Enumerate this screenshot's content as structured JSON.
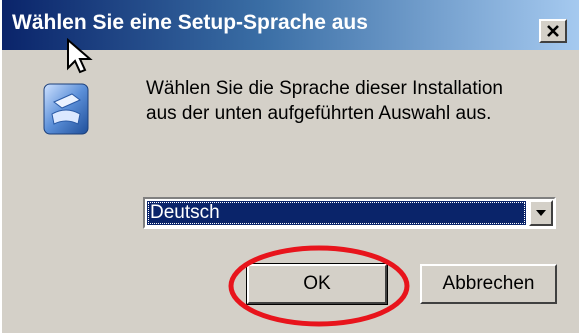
{
  "dialog": {
    "title": "Wählen Sie eine Setup-Sprache aus",
    "close_label": "✕",
    "message_lines": [
      "Wählen Sie die Sprache dieser Installation",
      "aus der unten aufgeführten Auswahl aus."
    ],
    "language_select": {
      "selected": "Deutsch"
    },
    "ok_label": "OK",
    "cancel_label": "Abbrechen"
  },
  "annotation": {
    "highlight_color": "#e8141c"
  },
  "icons": [
    "close-icon",
    "setup-app-icon",
    "chevron-down-icon",
    "mouse-cursor-icon"
  ]
}
